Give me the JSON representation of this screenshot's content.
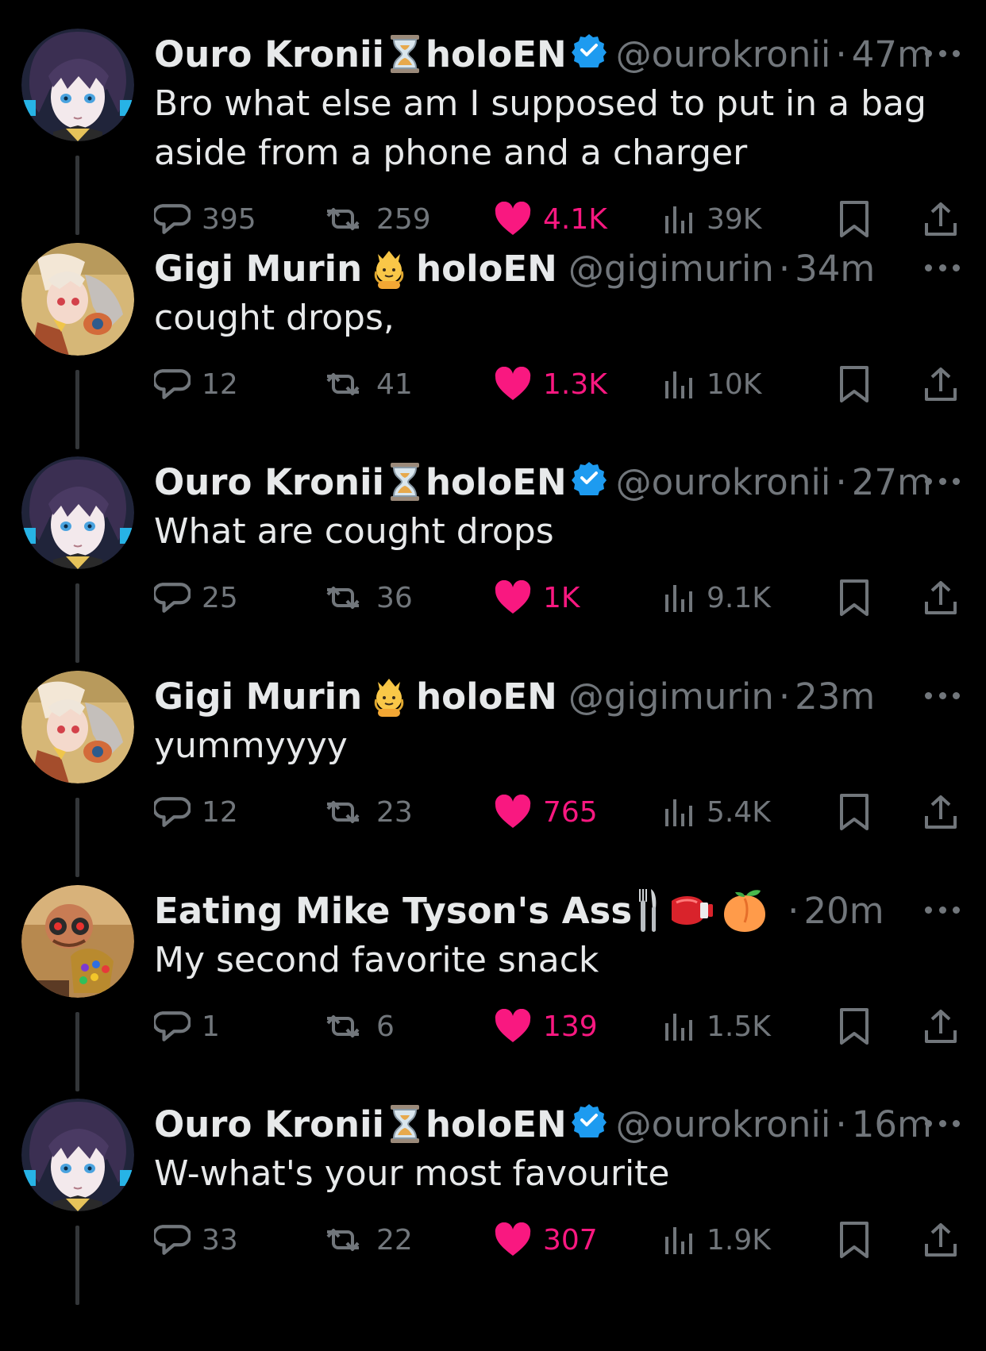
{
  "colors": {
    "background": "#000000",
    "text": "#e7e9ea",
    "muted": "#71767b",
    "like": "#f91880",
    "verified": "#1d9bf0",
    "thread_line": "#333639"
  },
  "icons": {
    "reply": "reply-icon",
    "retweet": "retweet-icon",
    "like": "heart-icon",
    "views": "views-icon",
    "bookmark": "bookmark-icon",
    "share": "share-icon",
    "more": "more-icon"
  },
  "tweets": [
    {
      "name": "Ouro Kronii",
      "emoji": "hourglass",
      "suffix": "holoEN",
      "verified": true,
      "handle": "@ourokronii",
      "sep": "·",
      "time": "47m",
      "text": "Bro what else am I supposed to put in a bag aside from a phone and a charger",
      "replies": "395",
      "retweets": "259",
      "likes": "4.1K",
      "views": "39K"
    },
    {
      "name": "Gigi Murin",
      "emoji": "person-with-crown",
      "suffix": "holoEN",
      "verified": false,
      "handle": "@gigimurin",
      "sep": "·",
      "time": "34m",
      "text": "cought drops,",
      "replies": "12",
      "retweets": "41",
      "likes": "1.3K",
      "views": "10K"
    },
    {
      "name": "Ouro Kronii",
      "emoji": "hourglass",
      "suffix": "holoEN",
      "verified": true,
      "handle": "@ourokronii",
      "sep": "·",
      "time": "27m",
      "text": "What are cought drops",
      "replies": "25",
      "retweets": "36",
      "likes": "1K",
      "views": "9.1K"
    },
    {
      "name": "Gigi Murin",
      "emoji": "person-with-crown",
      "suffix": "holoEN",
      "verified": false,
      "handle": "@gigimurin",
      "sep": "·",
      "time": "23m",
      "text": "yummyyyy",
      "replies": "12",
      "retweets": "23",
      "likes": "765",
      "views": "5.4K"
    },
    {
      "name": "Eating Mike Tyson's Ass",
      "emoji": "fork-and-knife boxing-glove peach",
      "suffix": "",
      "verified": false,
      "handle": "",
      "sep": "·",
      "time": "20m",
      "text": "My second favorite snack",
      "replies": "1",
      "retweets": "6",
      "likes": "139",
      "views": "1.5K"
    },
    {
      "name": "Ouro Kronii",
      "emoji": "hourglass",
      "suffix": "holoEN",
      "verified": true,
      "handle": "@ourokronii",
      "sep": "·",
      "time": "16m",
      "text": "W-what's your most favourite",
      "replies": "33",
      "retweets": "22",
      "likes": "307",
      "views": "1.9K"
    }
  ]
}
